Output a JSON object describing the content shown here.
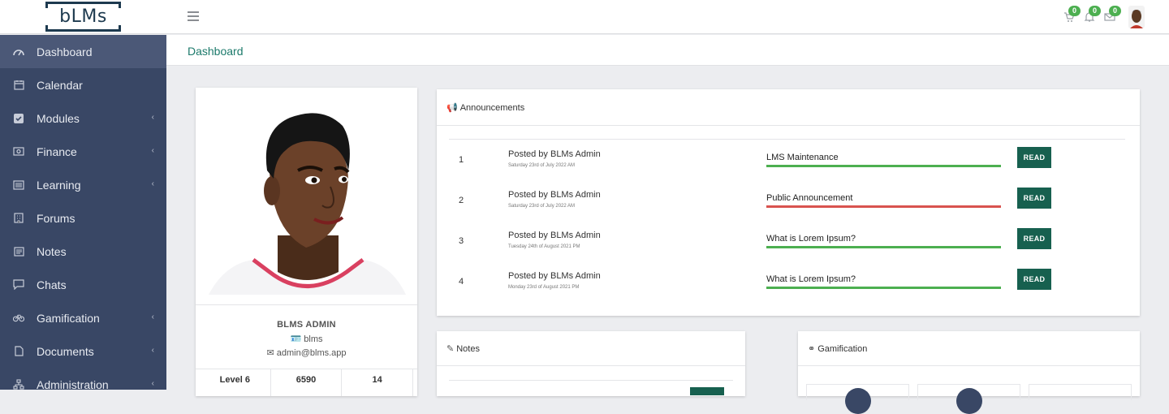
{
  "app": {
    "logo_text": "bLMs"
  },
  "topbar": {
    "cart_count": "0",
    "notifications_count": "0",
    "messages_count": "0"
  },
  "sidebar": {
    "items": [
      {
        "label": "Dashboard",
        "icon": "dashboard-icon",
        "active": true,
        "has_children": false
      },
      {
        "label": "Calendar",
        "icon": "calendar-icon",
        "has_children": false
      },
      {
        "label": "Modules",
        "icon": "checkbox-icon",
        "has_children": true
      },
      {
        "label": "Finance",
        "icon": "money-icon",
        "has_children": true
      },
      {
        "label": "Learning",
        "icon": "list-icon",
        "has_children": true
      },
      {
        "label": "Forums",
        "icon": "building-icon",
        "has_children": false
      },
      {
        "label": "Notes",
        "icon": "notes-icon",
        "has_children": false
      },
      {
        "label": "Chats",
        "icon": "chat-icon",
        "has_children": false
      },
      {
        "label": "Gamification",
        "icon": "bicycle-icon",
        "has_children": true
      },
      {
        "label": "Documents",
        "icon": "document-icon",
        "has_children": true
      },
      {
        "label": "Administration",
        "icon": "sitemap-icon",
        "has_children": true
      }
    ]
  },
  "breadcrumb": {
    "label": "Dashboard"
  },
  "profile": {
    "name": "BLMS ADMIN",
    "username": "blms",
    "email": "admin@blms.app",
    "stats": [
      "Level 6",
      "6590",
      "14"
    ]
  },
  "announcements": {
    "title": "Announcements",
    "read_label": "READ",
    "rows": [
      {
        "num": "1",
        "posted_by": "Posted by BLMs Admin",
        "date": "Saturday 23rd of July 2022 AM",
        "title": "LMS Maintenance",
        "status_color": "#4caf50"
      },
      {
        "num": "2",
        "posted_by": "Posted by BLMs Admin",
        "date": "Saturday 23rd of July 2022 AM",
        "title": "Public Announcement",
        "status_color": "#d9534f"
      },
      {
        "num": "3",
        "posted_by": "Posted by BLMs Admin",
        "date": "Tuesday 24th of August 2021 PM",
        "title": "What is Lorem Ipsum?",
        "status_color": "#4caf50"
      },
      {
        "num": "4",
        "posted_by": "Posted by BLMs Admin",
        "date": "Monday 23rd of August 2021 PM",
        "title": "What is Lorem Ipsum?",
        "status_color": "#4caf50"
      }
    ]
  },
  "notes": {
    "title": "Notes"
  },
  "gamification": {
    "title": "Gamification"
  },
  "colors": {
    "sidebar_bg": "#394765",
    "sidebar_active": "#4b5877",
    "accent": "#17604f",
    "breadcrumb": "#1c7a6b",
    "badge": "#4caf50"
  }
}
